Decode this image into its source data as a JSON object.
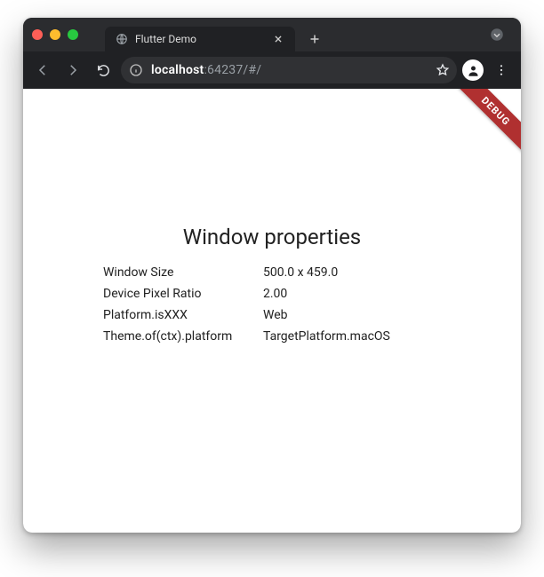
{
  "window": {
    "tab": {
      "title": "Flutter Demo"
    }
  },
  "toolbar": {
    "url_prefix": "localhost",
    "url_suffix": ":64237/#/"
  },
  "debug_label": "DEBUG",
  "page": {
    "heading": "Window properties",
    "rows": [
      {
        "label": "Window Size",
        "value": "500.0 x 459.0"
      },
      {
        "label": "Device Pixel Ratio",
        "value": "2.00"
      },
      {
        "label": "Platform.isXXX",
        "value": "Web"
      },
      {
        "label": "Theme.of(ctx).platform",
        "value": "TargetPlatform.macOS"
      }
    ]
  }
}
